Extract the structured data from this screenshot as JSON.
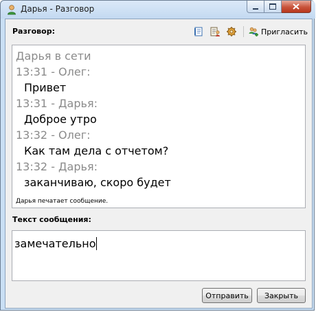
{
  "window": {
    "title": "Дарья - Разговор",
    "icon": "user-icon"
  },
  "conversation": {
    "label": "Разговор:",
    "toolbar": {
      "icons": [
        "history-icon",
        "contact-card-icon",
        "settings-icon"
      ],
      "invite_label": "Пригласить",
      "invite_icon": "add-users-icon"
    },
    "status": "Дарья в сети",
    "messages": [
      {
        "header": "13:31 - Олег:",
        "text": "Привет"
      },
      {
        "header": "13:31 - Дарья:",
        "text": "Доброе утро"
      },
      {
        "header": "13:32 - Олег:",
        "text": "Как там дела с отчетом?"
      },
      {
        "header": "13:32 - Дарья:",
        "text": "заканчиваю, скоро будет"
      }
    ],
    "typing_indicator": "Дарья печатает сообщение."
  },
  "composer": {
    "label": "Текст сообщения:",
    "value": "замечательно"
  },
  "buttons": {
    "send": "Отправить",
    "close": "Закрыть"
  },
  "colors": {
    "frame": "#c9dff4",
    "timestamp_gray": "#8b8b8b",
    "close_red": "#c8533b"
  }
}
